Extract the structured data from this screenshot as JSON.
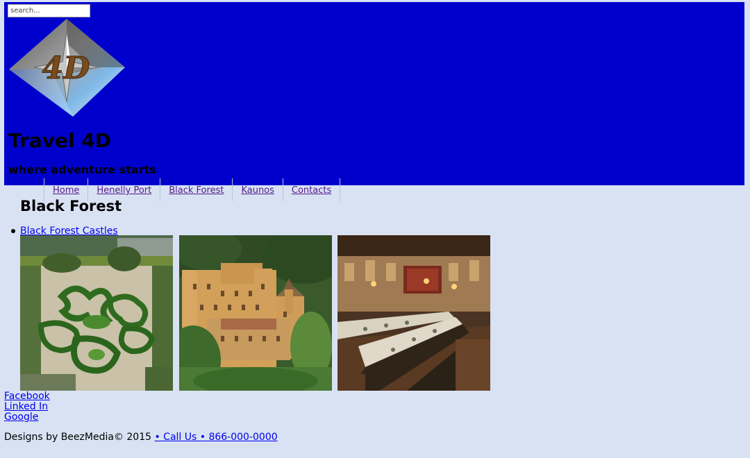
{
  "header": {
    "search_placeholder": "search...",
    "logo_text": "4D",
    "title": "Travel 4D",
    "tagline": "where adventure starts",
    "background": "#0000cd"
  },
  "nav": {
    "items": [
      {
        "label": "Home"
      },
      {
        "label": "Henelly Port"
      },
      {
        "label": "Black Forest"
      },
      {
        "label": "Kaunos"
      },
      {
        "label": "Contacts"
      }
    ]
  },
  "main": {
    "heading": "Black Forest",
    "subnav": [
      {
        "label": "Black Forest Castles"
      }
    ],
    "photos": [
      {
        "subject": "castle-garden"
      },
      {
        "subject": "castle-exterior"
      },
      {
        "subject": "castle-banquet-hall"
      }
    ]
  },
  "social": {
    "facebook": "Facebook",
    "linkedin": "Linked In",
    "google": "Google"
  },
  "footer": {
    "credit": "Designs by BeezMedia© 2015 ",
    "call_link": "• Call Us • 866-000-0000"
  }
}
